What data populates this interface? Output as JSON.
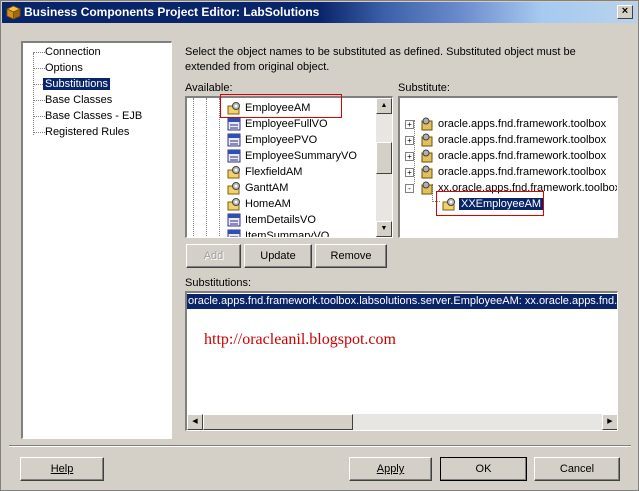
{
  "window": {
    "title": "Business Components Project Editor: LabSolutions",
    "close_glyph": "×"
  },
  "nav": {
    "items": [
      {
        "label": "Connection",
        "selected": false
      },
      {
        "label": "Options",
        "selected": false
      },
      {
        "label": "Substitutions",
        "selected": true
      },
      {
        "label": "Base Classes",
        "selected": false
      },
      {
        "label": "Base Classes - EJB",
        "selected": false
      },
      {
        "label": "Registered Rules",
        "selected": false
      }
    ]
  },
  "description": "Select the object names to be substituted as defined. Substituted object must be extended from original object.",
  "available": {
    "label": "Available:",
    "items": [
      {
        "label": "EmployeeAM",
        "icon": "application-module-icon",
        "highlighted": true
      },
      {
        "label": "EmployeeFullVO",
        "icon": "sql-view-object-icon"
      },
      {
        "label": "EmployeePVO",
        "icon": "sql-view-object-icon"
      },
      {
        "label": "EmployeeSummaryVO",
        "icon": "sql-view-object-icon"
      },
      {
        "label": "FlexfieldAM",
        "icon": "application-module-icon"
      },
      {
        "label": "GanttAM",
        "icon": "application-module-icon"
      },
      {
        "label": "HomeAM",
        "icon": "application-module-icon"
      },
      {
        "label": "ItemDetailsVO",
        "icon": "sql-view-object-icon"
      },
      {
        "label": "ItemSummaryVO",
        "icon": "sql-view-object-icon"
      }
    ]
  },
  "substitute": {
    "label": "Substitute:",
    "items": [
      {
        "label": "oracle.apps.fnd.framework.toolbox",
        "expander": "+"
      },
      {
        "label": "oracle.apps.fnd.framework.toolbox",
        "expander": "+"
      },
      {
        "label": "oracle.apps.fnd.framework.toolbox",
        "expander": "+"
      },
      {
        "label": "oracle.apps.fnd.framework.toolbox",
        "expander": "+"
      },
      {
        "label": "xx.oracle.apps.fnd.framework.toolbox",
        "expander": "-"
      }
    ],
    "child": {
      "label": "XXEmployeeAM",
      "selected": true
    }
  },
  "actions": {
    "add": "Add",
    "update": "Update",
    "remove": "Remove"
  },
  "substitutions": {
    "label": "Substitutions:",
    "rows": [
      "oracle.apps.fnd.framework.toolbox.labsolutions.server.EmployeeAM: xx.oracle.apps.fnd.framework.toolbox.labsolutions.server.XXEmployeeAM"
    ]
  },
  "watermark": "http://oracleanil.blogspot.com",
  "footer": {
    "help": "Help",
    "apply": "Apply",
    "ok": "OK",
    "cancel": "Cancel"
  },
  "colors": {
    "selection": "#0a246a",
    "highlight_box": "#e00000",
    "watermark": "#cc0000",
    "dialog_bg": "#d4d0c8"
  }
}
